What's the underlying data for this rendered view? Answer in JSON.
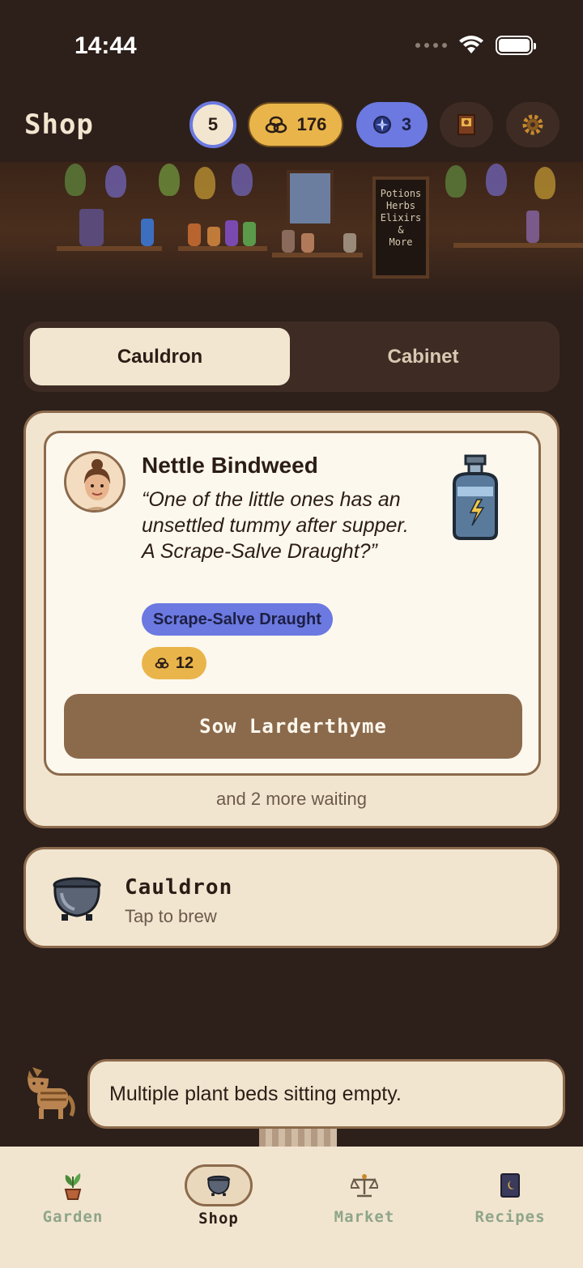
{
  "status_bar": {
    "time": "14:44"
  },
  "header": {
    "title": "Shop",
    "level": "5",
    "coins": "176",
    "gems": "3"
  },
  "banner": {
    "sign_lines": [
      "Potions",
      "Herbs",
      "Elixirs",
      "&",
      "More"
    ]
  },
  "tabs": [
    {
      "label": "Cauldron",
      "active": true
    },
    {
      "label": "Cabinet",
      "active": false
    }
  ],
  "order": {
    "customer_name": "Nettle Bindweed",
    "quote": "“One of the little ones has an unsettled tummy after supper. A Scrape-Salve Draught?”",
    "item": "Scrape-Salve Draught",
    "reward": "12",
    "action_label": "Sow Larderthyme",
    "more_waiting": "and 2 more waiting"
  },
  "cauldron": {
    "title": "Cauldron",
    "subtitle": "Tap to brew"
  },
  "hint": {
    "text": "Multiple plant beds sitting empty."
  },
  "nav": [
    {
      "label": "Garden",
      "icon": "potted-plant-icon",
      "active": false
    },
    {
      "label": "Shop",
      "icon": "cauldron-icon",
      "active": true
    },
    {
      "label": "Market",
      "icon": "scales-icon",
      "active": false
    },
    {
      "label": "Recipes",
      "icon": "recipe-book-icon",
      "active": false
    }
  ],
  "colors": {
    "background": "#2d1f1a",
    "card": "#f2e5cf",
    "accent_blue": "#6b79e0",
    "accent_gold": "#e9b54a",
    "button_brown": "#8b6a4c"
  }
}
